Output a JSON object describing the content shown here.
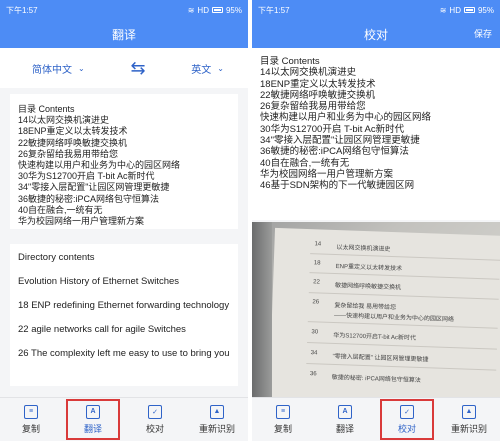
{
  "status": {
    "time": "下午1:57",
    "network": "HD",
    "battery": "95%"
  },
  "left": {
    "title": "翻译",
    "source_lang": "简体中文",
    "target_lang": "英文",
    "source_lines": [
      "目录 Contents",
      "14以太网交换机演进史",
      "18ENP重定义以太转发技术",
      "22敏捷网络呼唤敏捷交换机",
      "26复杂留给我易用带给您",
      "快速构建以用户和业务为中心的园区网络",
      "30华为S12700开启 T-bit Ac新时代",
      "34\"零接入层配置\"让园区网管理更敏捷",
      "36敏捷的秘密:iPCA网络包守恒算法",
      "40自在融合,一统有无",
      "华为校园网络一用户管理新方案"
    ],
    "translation": [
      "Directory contents",
      "Evolution History of Ethernet Switches",
      "18 ENP redefining Ethernet forwarding technology",
      "22 agile networks call for agile Switches",
      "26 The complexity left me easy to use to bring you"
    ]
  },
  "right": {
    "title": "校对",
    "save_label": "保存",
    "lines": [
      "目录 Contents",
      "14以太网交换机演进史",
      "18ENP重定义以太转发技术",
      "22敏捷网络呼唤敏捷交换机",
      "26复杂留给我易用带给您",
      "快速构建以用户和业务为中心的园区网络",
      "30华为S12700开启 T-bit Ac新时代",
      "34\"零接入层配置\"让园区网管理更敏捷",
      "36敏捷的秘密:iPCA网络包守恒算法",
      "40自在融合,一统有无",
      "华为校园网络一用户管理新方案",
      "46基于SDN架构的下一代敏捷园区网"
    ],
    "photo": {
      "items": [
        {
          "num": "14",
          "text": "以太网交换机演进史"
        },
        {
          "num": "18",
          "text": "ENP重定义以太转发技术"
        },
        {
          "num": "22",
          "text": "敏捷网络呼唤敏捷交换机"
        },
        {
          "num": "26",
          "text": "复杂留给我 易用带给您"
        },
        {
          "num": "",
          "text": "——快速构建以用户和业务为中心的园区网络"
        },
        {
          "num": "30",
          "text": "华为S12700开启T-bit Ac新时代"
        },
        {
          "num": "34",
          "text": "\"零接入层配置\" 让园区网管理更敏捷"
        },
        {
          "num": "36",
          "text": "敏捷的秘密: iPCA网络包守恒算法"
        }
      ]
    }
  },
  "tabs": [
    "复制",
    "翻译",
    "校对",
    "重新识别"
  ],
  "colors": {
    "primary": "#4d8cf5",
    "accent": "#2f63c8",
    "highlight": "#d93a3a"
  }
}
